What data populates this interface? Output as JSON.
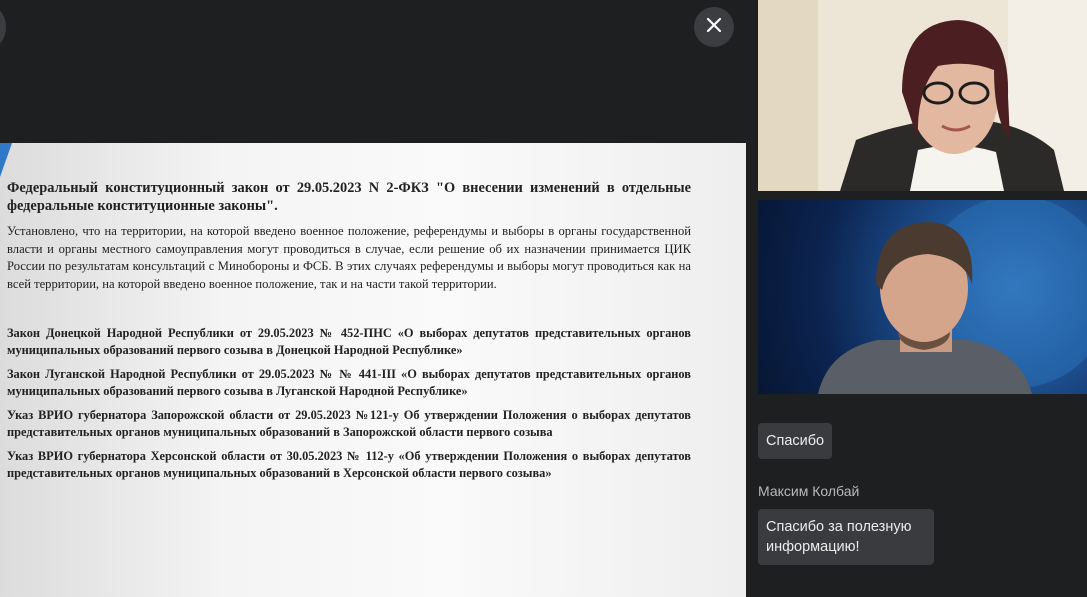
{
  "controls": {
    "close_glyph": "✕"
  },
  "slide": {
    "title": "Федеральный конституционный закон от 29.05.2023 N 2-ФКЗ \"О внесении изменений в отдельные федеральные конституционные законы\".",
    "intro": "Установлено, что на территории, на которой введено военное положение, референдумы и выборы в органы государственной власти и органы местного самоуправления могут проводиться в случае, если решение об их назначении принимается ЦИК России по результатам консультаций с Минобороны и ФСБ. В этих случаях референдумы и выборы могут проводиться как на всей территории, на которой введено военное положение, так и на части такой территории.",
    "items": [
      "Закон Донецкой Народной Республики от 29.05.2023 № 452-ПНС «О выборах депутатов представительных органов муниципальных образований первого созыва в Донецкой Народной Республике»",
      "Закон Луганской Народной Республики от 29.05.2023 № № 441-III «О выборах депутатов представительных органов муниципальных образований первого созыва в Луганской Народной Республике»",
      "Указ ВРИО губернатора Запорожской области от 29.05.2023 №121-у Об утверждении Положения о выборах депутатов представительных органов муниципальных образований в Запорожской области первого созыва",
      "Указ ВРИО губернатора Херсонской области от 30.05.2023 № 112-у «Об утверждении Положения о выборах депутатов представительных органов муниципальных образований в Херсонской области первого созыва»"
    ]
  },
  "chat": {
    "messages": [
      {
        "text": "Спасибо"
      },
      {
        "author": "Максим Колбай",
        "text": "Спасибо за полезную информацию!"
      }
    ]
  }
}
